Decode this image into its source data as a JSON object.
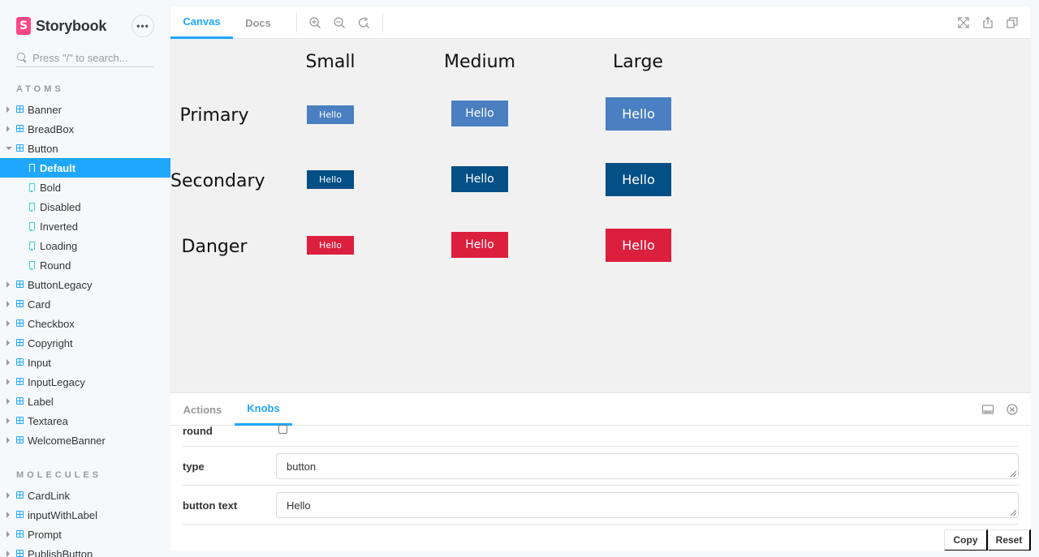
{
  "sidebar": {
    "brand_mark": "S",
    "brand_name": "Storybook",
    "menu_label": "•••",
    "search_placeholder": "Press \"/\" to search...",
    "atoms_title": "ATOMS",
    "molecules_title": "MOLECULES",
    "atoms_before": [
      "Banner",
      "BreadBox"
    ],
    "button_component": "Button",
    "button_stories": [
      "Default",
      "Bold",
      "Disabled",
      "Inverted",
      "Loading",
      "Round"
    ],
    "atoms_after": [
      "ButtonLegacy",
      "Card",
      "Checkbox",
      "Copyright",
      "Input",
      "InputLegacy",
      "Label",
      "Textarea",
      "WelcomeBanner"
    ],
    "molecules": [
      "CardLink",
      "inputWithLabel",
      "Prompt",
      "PublishButton"
    ]
  },
  "toolbar": {
    "tab_canvas": "Canvas",
    "tab_docs": "Docs",
    "zoom_in_icon": "zoom-in-icon",
    "zoom_out_icon": "zoom-out-icon",
    "zoom_reset_icon": "zoom-reset-icon",
    "fullscreen_icon": "fullscreen-icon",
    "share_icon": "share-icon",
    "copy_link_icon": "copy-icon"
  },
  "canvas": {
    "col_small": "Small",
    "col_medium": "Medium",
    "col_large": "Large",
    "row_primary": "Primary",
    "row_secondary": "Secondary",
    "row_danger": "Danger",
    "button_text": "Hello",
    "colors": {
      "primary": "#4a7fc1",
      "secondary": "#034f86",
      "danger": "#dc1f3d"
    }
  },
  "addons": {
    "tab_actions": "Actions",
    "tab_knobs": "Knobs",
    "knob_round_label": "round",
    "knob_type_label": "type",
    "knob_type_value": "button",
    "knob_text_label": "button text",
    "knob_text_value": "Hello",
    "copy_label": "Copy",
    "reset_label": "Reset"
  },
  "colors": {
    "accent": "#1ea7fd",
    "brand": "#ff4785",
    "story_icon": "#37d5d3"
  }
}
